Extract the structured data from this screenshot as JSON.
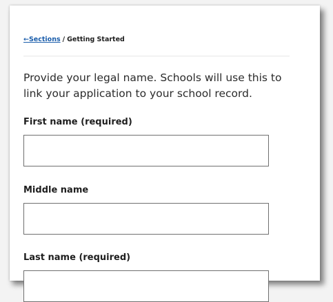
{
  "breadcrumb": {
    "link_label": "←Sections",
    "separator": "/",
    "current": "Getting Started"
  },
  "intro_text": "Provide your legal name. Schools will use this to link your application to your school record.",
  "fields": [
    {
      "label": "First name (required)",
      "value": "",
      "placeholder": ""
    },
    {
      "label": "Middle name",
      "value": "",
      "placeholder": ""
    },
    {
      "label": "Last name (required)",
      "value": "",
      "placeholder": ""
    }
  ]
}
